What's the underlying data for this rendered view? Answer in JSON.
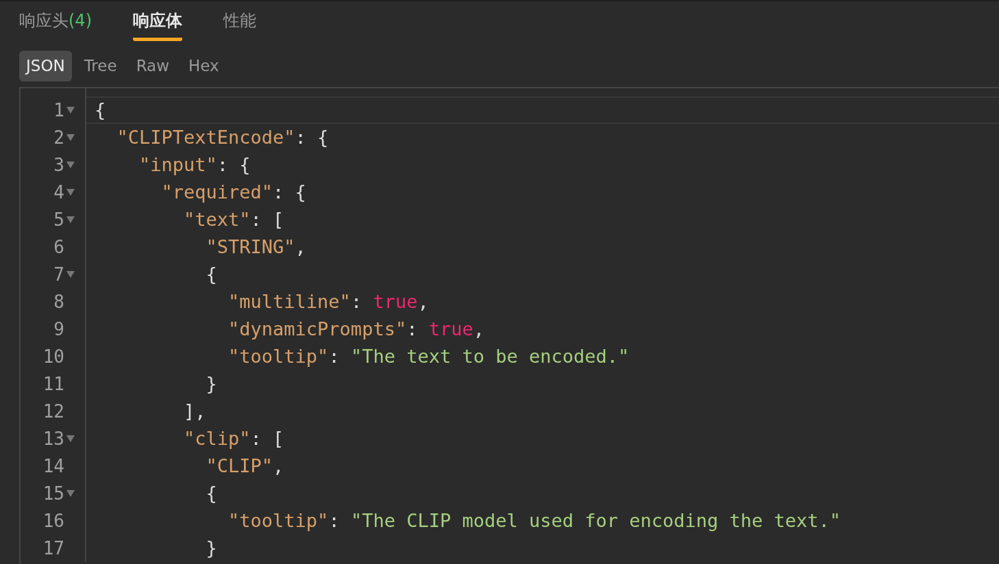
{
  "tabs": [
    {
      "label": "响应头",
      "count": "(4)",
      "selected": false
    },
    {
      "label": "响应体",
      "selected": true
    },
    {
      "label": "性能",
      "selected": false
    }
  ],
  "view_tabs": [
    {
      "label": "JSON",
      "selected": true
    },
    {
      "label": "Tree",
      "selected": false
    },
    {
      "label": "Raw",
      "selected": false
    },
    {
      "label": "Hex",
      "selected": false
    }
  ],
  "editor": {
    "lines": [
      {
        "number": "1",
        "foldable": true,
        "active": true,
        "tokens": [
          {
            "kind": "punct",
            "text": "{"
          }
        ]
      },
      {
        "number": "2",
        "foldable": true,
        "active": false,
        "tokens": [
          {
            "kind": "key",
            "text": "  \"CLIPTextEncode\""
          },
          {
            "kind": "punct",
            "text": ": {"
          }
        ]
      },
      {
        "number": "3",
        "foldable": true,
        "active": false,
        "tokens": [
          {
            "kind": "key",
            "text": "    \"input\""
          },
          {
            "kind": "punct",
            "text": ": {"
          }
        ]
      },
      {
        "number": "4",
        "foldable": true,
        "active": false,
        "tokens": [
          {
            "kind": "key",
            "text": "      \"required\""
          },
          {
            "kind": "punct",
            "text": ": {"
          }
        ]
      },
      {
        "number": "5",
        "foldable": true,
        "active": false,
        "tokens": [
          {
            "kind": "key",
            "text": "        \"text\""
          },
          {
            "kind": "punct",
            "text": ": ["
          }
        ]
      },
      {
        "number": "6",
        "foldable": false,
        "active": false,
        "tokens": [
          {
            "kind": "key",
            "text": "          \"STRING\""
          },
          {
            "kind": "punct",
            "text": ","
          }
        ]
      },
      {
        "number": "7",
        "foldable": true,
        "active": false,
        "tokens": [
          {
            "kind": "punct",
            "text": "          {"
          }
        ]
      },
      {
        "number": "8",
        "foldable": false,
        "active": false,
        "tokens": [
          {
            "kind": "key",
            "text": "            \"multiline\""
          },
          {
            "kind": "punct",
            "text": ": "
          },
          {
            "kind": "bool",
            "text": "true"
          },
          {
            "kind": "punct",
            "text": ","
          }
        ]
      },
      {
        "number": "9",
        "foldable": false,
        "active": false,
        "tokens": [
          {
            "kind": "key",
            "text": "            \"dynamicPrompts\""
          },
          {
            "kind": "punct",
            "text": ": "
          },
          {
            "kind": "bool",
            "text": "true"
          },
          {
            "kind": "punct",
            "text": ","
          }
        ]
      },
      {
        "number": "10",
        "foldable": false,
        "active": false,
        "tokens": [
          {
            "kind": "key",
            "text": "            \"tooltip\""
          },
          {
            "kind": "punct",
            "text": ": "
          },
          {
            "kind": "string",
            "text": "\"The text to be encoded.\""
          }
        ]
      },
      {
        "number": "11",
        "foldable": false,
        "active": false,
        "tokens": [
          {
            "kind": "punct",
            "text": "          }"
          }
        ]
      },
      {
        "number": "12",
        "foldable": false,
        "active": false,
        "tokens": [
          {
            "kind": "punct",
            "text": "        ],"
          }
        ]
      },
      {
        "number": "13",
        "foldable": true,
        "active": false,
        "tokens": [
          {
            "kind": "key",
            "text": "        \"clip\""
          },
          {
            "kind": "punct",
            "text": ": ["
          }
        ]
      },
      {
        "number": "14",
        "foldable": false,
        "active": false,
        "tokens": [
          {
            "kind": "key",
            "text": "          \"CLIP\""
          },
          {
            "kind": "punct",
            "text": ","
          }
        ]
      },
      {
        "number": "15",
        "foldable": true,
        "active": false,
        "tokens": [
          {
            "kind": "punct",
            "text": "          {"
          }
        ]
      },
      {
        "number": "16",
        "foldable": false,
        "active": false,
        "tokens": [
          {
            "kind": "key",
            "text": "            \"tooltip\""
          },
          {
            "kind": "punct",
            "text": ": "
          },
          {
            "kind": "string",
            "text": "\"The CLIP model used for encoding the text.\""
          }
        ]
      },
      {
        "number": "17",
        "foldable": false,
        "active": false,
        "tokens": [
          {
            "kind": "punct",
            "text": "          }"
          }
        ]
      }
    ]
  }
}
